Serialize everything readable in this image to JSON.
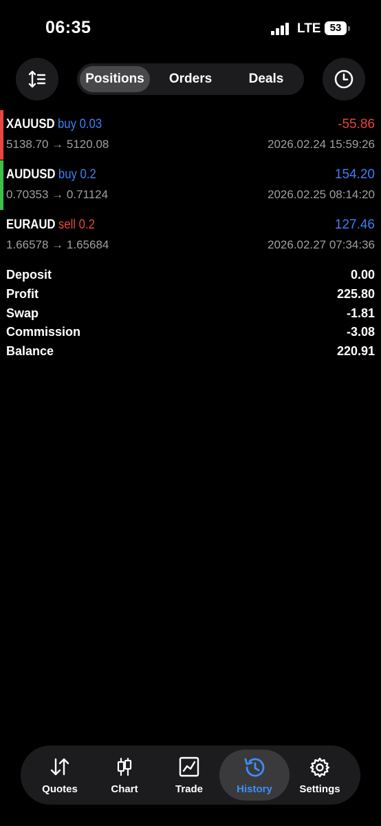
{
  "status_bar": {
    "time": "06:35",
    "network": "LTE",
    "battery": "53"
  },
  "header": {
    "segments": [
      {
        "label": "Positions",
        "active": true
      },
      {
        "label": "Orders",
        "active": false
      },
      {
        "label": "Deals",
        "active": false
      }
    ],
    "left_icon": "sort-icon",
    "right_icon": "clock-icon"
  },
  "trades": [
    {
      "symbol": "XAUUSD",
      "side": "buy 0.03",
      "side_color": "#3f7ff5",
      "bar_color": "#e8463f",
      "profit": "-55.86",
      "profit_color": "#e8463f",
      "prices": "5138.70 → 5120.08",
      "time": "2026.02.24 15:59:26"
    },
    {
      "symbol": "AUDUSD",
      "side": "buy 0.2",
      "side_color": "#3f7ff5",
      "bar_color": "#3cc04a",
      "profit": "154.20",
      "profit_color": "#3f7ff5",
      "prices": "0.70353 → 0.71124",
      "time": "2026.02.25 08:14:20"
    },
    {
      "symbol": "EURAUD",
      "side": "sell 0.2",
      "side_color": "#e8463f",
      "bar_color": "#000000",
      "profit": "127.46",
      "profit_color": "#3f7ff5",
      "prices": "1.66578 → 1.65684",
      "time": "2026.02.27 07:34:36"
    }
  ],
  "summary": [
    {
      "label": "Deposit",
      "value": "0.00"
    },
    {
      "label": "Profit",
      "value": "225.80"
    },
    {
      "label": "Swap",
      "value": "-1.81"
    },
    {
      "label": "Commission",
      "value": "-3.08"
    },
    {
      "label": "Balance",
      "value": "220.91"
    }
  ],
  "tabbar": [
    {
      "label": "Quotes",
      "icon": "quotes-arrows-icon",
      "active": false
    },
    {
      "label": "Chart",
      "icon": "candlestick-icon",
      "active": false
    },
    {
      "label": "Trade",
      "icon": "trade-chart-icon",
      "active": false
    },
    {
      "label": "History",
      "icon": "history-icon",
      "active": true
    },
    {
      "label": "Settings",
      "icon": "gear-icon",
      "active": false
    }
  ]
}
